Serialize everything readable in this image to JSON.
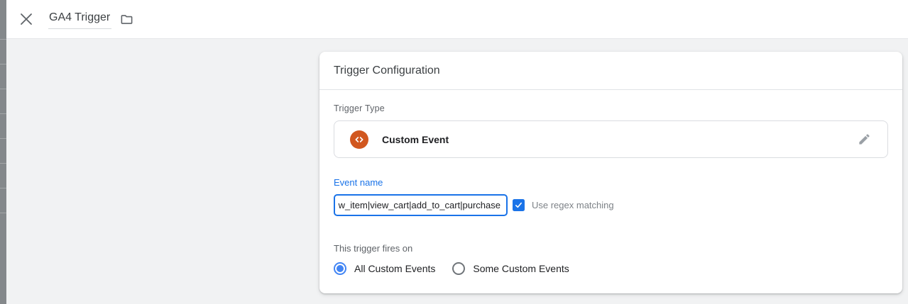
{
  "topbar": {
    "title": "GA4 Trigger",
    "close_icon": "close-x",
    "folder_icon": "folder"
  },
  "card": {
    "title": "Trigger Configuration",
    "trigger_type": {
      "label": "Trigger Type",
      "value": "Custom Event",
      "icon": "custom-event-code-brackets",
      "edit_icon": "pencil"
    },
    "event_name": {
      "label": "Event name",
      "value": "w_item|view_cart|add_to_cart|purchase",
      "regex": {
        "checked": true,
        "label": "Use regex matching"
      }
    },
    "fires_on": {
      "label": "This trigger fires on",
      "options": [
        {
          "label": "All Custom Events",
          "selected": true
        },
        {
          "label": "Some Custom Events",
          "selected": false
        }
      ]
    }
  },
  "colors": {
    "accent_blue": "#1a73e8",
    "radio_blue": "#4285f4",
    "event_icon_orange": "#D1571F",
    "page_background": "#f1f2f3",
    "card_background": "#ffffff",
    "label_gray": "#5f6368"
  }
}
